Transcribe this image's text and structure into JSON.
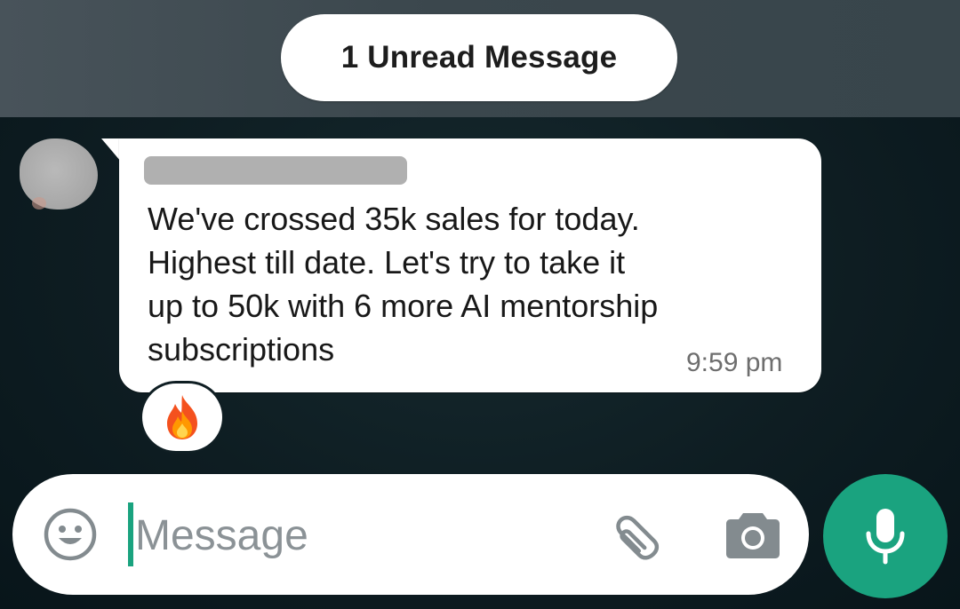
{
  "banner": {
    "unread_label": "1 Unread Message"
  },
  "message": {
    "lines": [
      "We've crossed 35k sales for today.",
      "Highest till date. Let's try to take it",
      "up to 50k with 6 more AI mentorship",
      "subscriptions"
    ],
    "time": "9:59 pm",
    "reaction_icon": "fire-emoji"
  },
  "composer": {
    "placeholder": "Message",
    "icons": [
      "emoji-icon",
      "paperclip-icon",
      "camera-icon",
      "microphone-icon"
    ]
  },
  "colors": {
    "accent": "#1aa37f",
    "bubble": "#ffffff",
    "chat_background": "#0e1d22",
    "header_band": "#3d494f"
  }
}
